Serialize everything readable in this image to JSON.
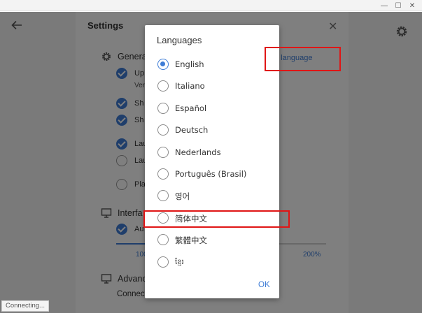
{
  "window": {
    "controls": {
      "minimize": "—",
      "maximize": "☐",
      "close": "✕"
    }
  },
  "settings": {
    "title": "Settings",
    "close_glyph": "✕",
    "general_label": "Genera",
    "interface_label": "Interfa",
    "advanced_label": "Advanc",
    "options": [
      {
        "label": "Up",
        "checked": true
      },
      {
        "label": "Sh",
        "checked": true
      },
      {
        "label": "Sh",
        "checked": true
      },
      {
        "label": "Lau",
        "checked": true
      },
      {
        "label": "Lau",
        "checked": false
      },
      {
        "label": "Pla",
        "checked": false
      },
      {
        "label": "Au",
        "checked": true
      }
    ],
    "version_sublabel": "Ver",
    "language_link": "e language",
    "zoom": {
      "min_label": "100",
      "max_label": "200%",
      "fill_fraction": 0.23
    },
    "connect_label": "Connect"
  },
  "status_chip": "Connecting...",
  "dialog": {
    "title": "Languages",
    "languages": [
      {
        "label": "English",
        "selected": true
      },
      {
        "label": "Italiano",
        "selected": false
      },
      {
        "label": "Español",
        "selected": false
      },
      {
        "label": "Deutsch",
        "selected": false
      },
      {
        "label": "Nederlands",
        "selected": false
      },
      {
        "label": "Português (Brasil)",
        "selected": false
      },
      {
        "label": "영어",
        "selected": false
      },
      {
        "label": "简体中文",
        "selected": false
      },
      {
        "label": "繁體中文",
        "selected": false
      },
      {
        "label": "ខ្មែរ",
        "selected": false
      }
    ],
    "ok_label": "OK"
  },
  "colors": {
    "accent": "#3f7dd6",
    "highlight": "#e01515"
  }
}
